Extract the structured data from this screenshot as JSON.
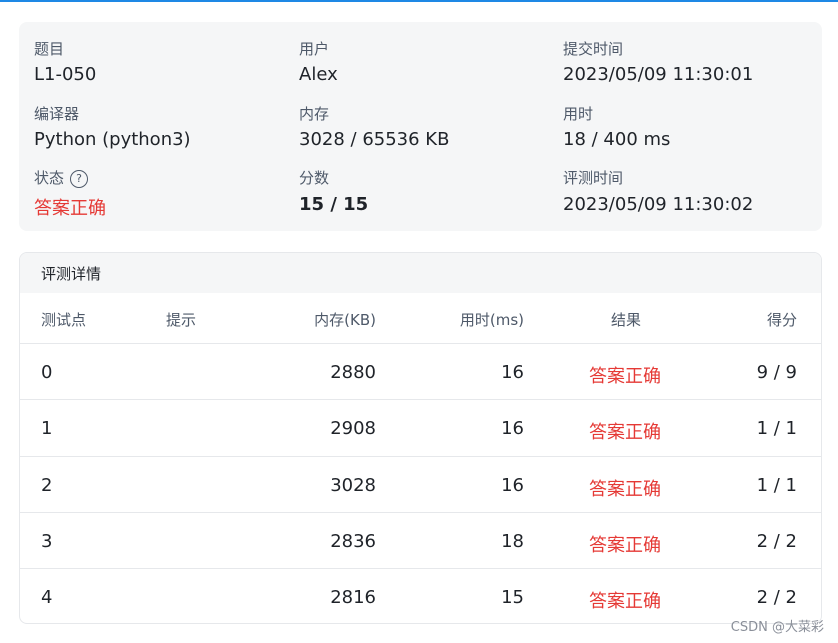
{
  "info": {
    "problem_label": "题目",
    "problem_value": "L1-050",
    "user_label": "用户",
    "user_value": "Alex",
    "submit_time_label": "提交时间",
    "submit_time_value": "2023/05/09 11:30:01",
    "compiler_label": "编译器",
    "compiler_value": "Python (python3)",
    "memory_label": "内存",
    "memory_value": "3028 / 65536 KB",
    "time_label": "用时",
    "time_value": "18 / 400 ms",
    "status_label": "状态",
    "status_value": "答案正确",
    "score_label": "分数",
    "score_value": "15 / 15",
    "judge_time_label": "评测时间",
    "judge_time_value": "2023/05/09 11:30:02",
    "help_icon": "?"
  },
  "details": {
    "title": "评测详情",
    "columns": {
      "id": "测试点",
      "hint": "提示",
      "memory": "内存(KB)",
      "time": "用时(ms)",
      "result": "结果",
      "score": "得分"
    },
    "rows": [
      {
        "id": "0",
        "hint": "",
        "memory": "2880",
        "time": "16",
        "result": "答案正确",
        "score": "9 / 9"
      },
      {
        "id": "1",
        "hint": "",
        "memory": "2908",
        "time": "16",
        "result": "答案正确",
        "score": "1 / 1"
      },
      {
        "id": "2",
        "hint": "",
        "memory": "3028",
        "time": "16",
        "result": "答案正确",
        "score": "1 / 1"
      },
      {
        "id": "3",
        "hint": "",
        "memory": "2836",
        "time": "18",
        "result": "答案正确",
        "score": "2 / 2"
      },
      {
        "id": "4",
        "hint": "",
        "memory": "2816",
        "time": "15",
        "result": "答案正确",
        "score": "2 / 2"
      }
    ]
  },
  "watermark": "CSDN @大菜彩",
  "colors": {
    "accent": "#1e88e5",
    "success_text": "#e53935"
  }
}
